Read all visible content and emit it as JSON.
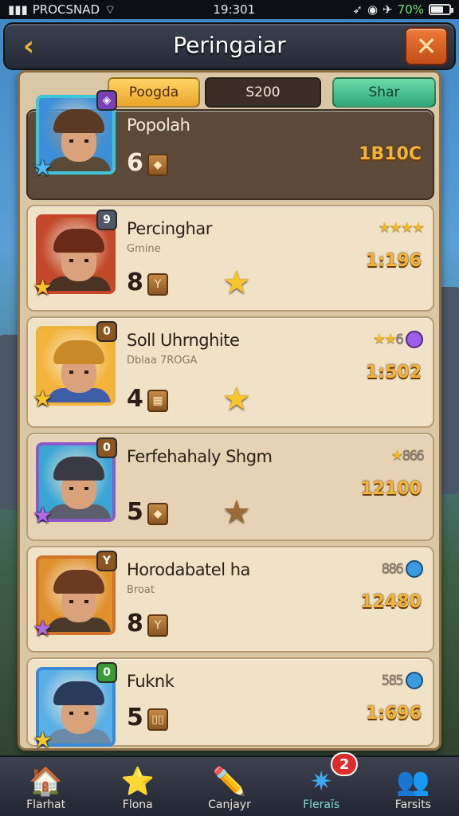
{
  "status_bar": {
    "carrier": "PROCSNAD",
    "time": "19:301",
    "battery_pct": "70%",
    "battery_level": 0.7
  },
  "header": {
    "title": "Peringaiar",
    "back_icon": "chevron-left-icon",
    "close_icon": "close-icon"
  },
  "tabs": [
    {
      "label": "Poogda",
      "color": "#eca52a"
    },
    {
      "label": "S200",
      "color": "#3a2f27"
    },
    {
      "label": "Shar",
      "color": "#2fa877"
    }
  ],
  "heroes": [
    {
      "name": "Popolah",
      "subtitle": "",
      "level": "6",
      "slot_glyph": "◆",
      "power": "1B10C",
      "stars_right": "",
      "right_number": "",
      "gem": "",
      "badge": "◈",
      "badge_color": "#7a3fb5",
      "corner_star_color": "#4fb8f0",
      "frame_color": "#3fc6d6",
      "hat_color": "#5a3a22",
      "body_color": "#5a4a3a",
      "bg_color": "#3c8fd8",
      "mid_star": "none"
    },
    {
      "name": "Percinghar",
      "subtitle": "Gmine",
      "level": "8",
      "slot_glyph": "Y",
      "power": "1:196",
      "stars_right": "★★★★",
      "right_number": "",
      "gem": "",
      "badge": "9",
      "badge_color": "#4e5866",
      "corner_star_color": "#f8c52c",
      "frame_color": "#c9452a",
      "hat_color": "#6a2a18",
      "body_color": "#4a3324",
      "bg_color": "#c24a2b",
      "mid_star": "gold"
    },
    {
      "name": "Soll Uhrnghite",
      "subtitle": "Dblaa 7ROGA",
      "level": "4",
      "slot_glyph": "▦",
      "power": "1:502",
      "stars_right": "★★",
      "right_number": "6",
      "gem": "purple",
      "badge": "0",
      "badge_color": "#8c5622",
      "corner_star_color": "#f8c52c",
      "frame_color": "#f0b33a",
      "hat_color": "#c98a2a",
      "body_color": "#3e5fa8",
      "bg_color": "#f4b43c",
      "mid_star": "gold"
    },
    {
      "name": "Ferfehahaly Shgm",
      "subtitle": "",
      "level": "5",
      "slot_glyph": "◆",
      "power": "12100",
      "stars_right": "★",
      "right_number": "866",
      "gem": "",
      "badge": "0",
      "badge_color": "#8c5622",
      "corner_star_color": "#b06ae8",
      "frame_color": "#8a58c9",
      "hat_color": "#3a3a44",
      "body_color": "#5b5f6b",
      "bg_color": "#3aa6d6",
      "mid_star": "dim"
    },
    {
      "name": "Horodabatel ha",
      "subtitle": "Broat",
      "level": "8",
      "slot_glyph": "Y",
      "power": "12480",
      "stars_right": "",
      "right_number": "886",
      "gem": "blue",
      "badge": "Y",
      "badge_color": "#8c5622",
      "corner_star_color": "#b06ae8",
      "frame_color": "#d0742a",
      "hat_color": "#6a3a20",
      "body_color": "#4a3a2a",
      "bg_color": "#e0902c",
      "mid_star": "none"
    },
    {
      "name": "Fuknk",
      "subtitle": "",
      "level": "5",
      "slot_glyph": "▯▯",
      "power": "1:696",
      "stars_right": "",
      "right_number": "585",
      "gem": "blue",
      "badge": "0",
      "badge_color": "#3a9a3a",
      "corner_star_color": "#f8c52c",
      "frame_color": "#3a8ad6",
      "hat_color": "#2a3a5a",
      "body_color": "#6a8aa8",
      "bg_color": "#5ab0e6",
      "mid_star": "none"
    }
  ],
  "bottom_nav": [
    {
      "label": "Flarhat",
      "icon": "house-icon",
      "glyph": "🏠"
    },
    {
      "label": "Flona",
      "icon": "star-icon",
      "glyph": "⭐"
    },
    {
      "label": "Canjayr",
      "icon": "pencil-card-icon",
      "glyph": "✏️"
    },
    {
      "label": "Fleraïs",
      "icon": "badge-star-icon",
      "glyph": "✷",
      "active": true,
      "notification": "2"
    },
    {
      "label": "Farsits",
      "icon": "group-icon",
      "glyph": "👥"
    }
  ]
}
